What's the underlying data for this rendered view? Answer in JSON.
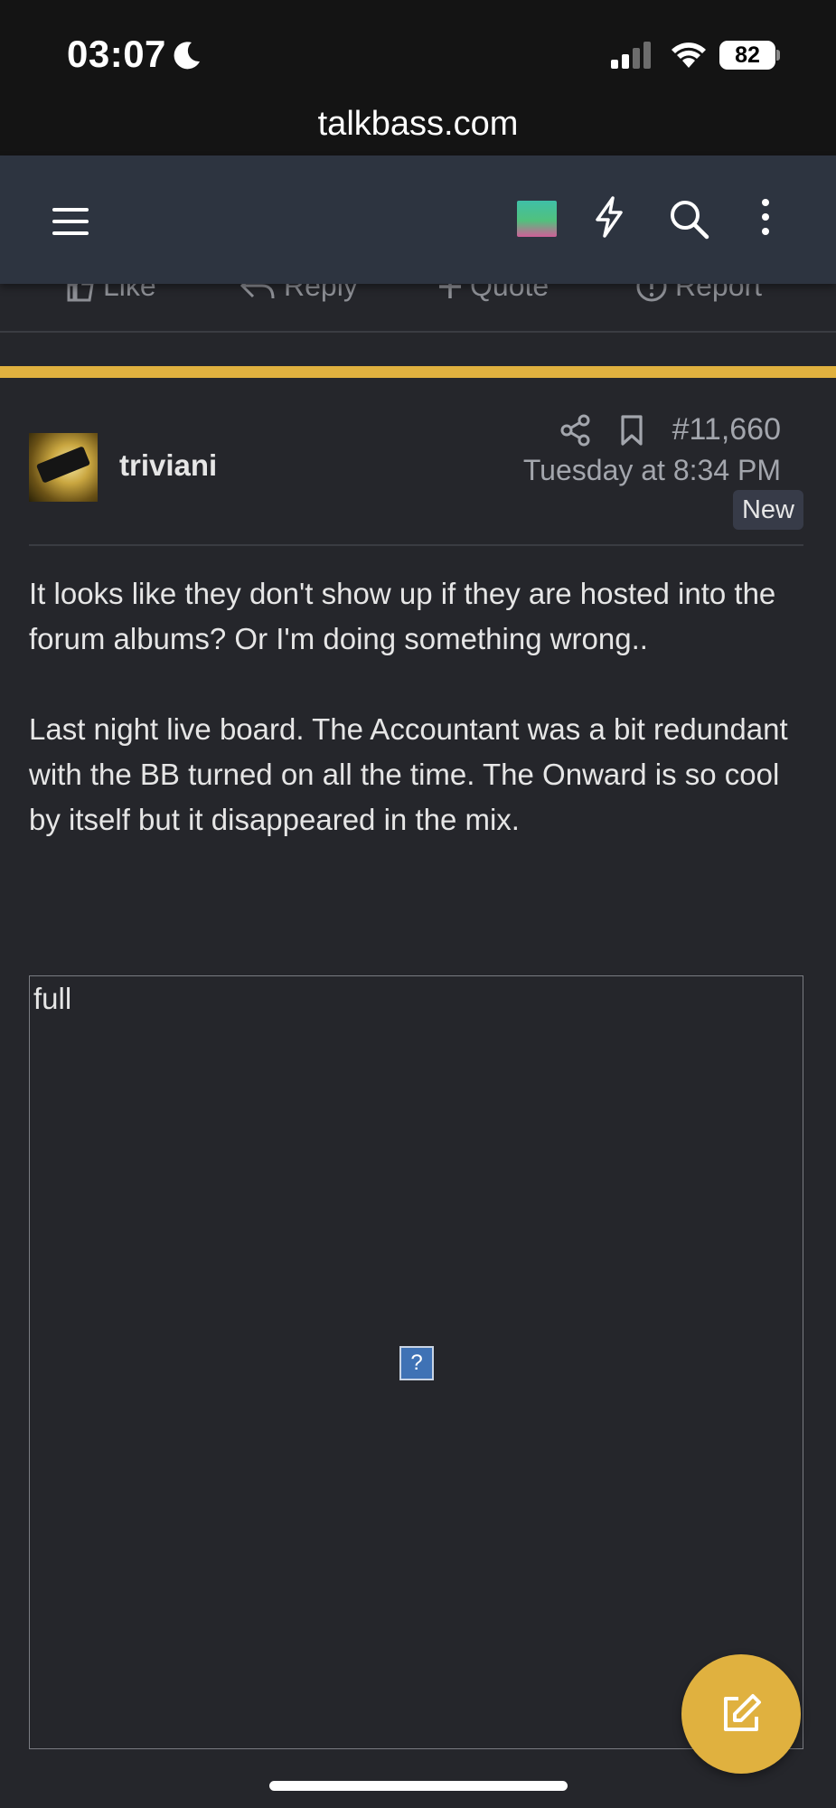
{
  "status_bar": {
    "time": "03:07",
    "battery": "82"
  },
  "browser": {
    "url": "talkbass.com"
  },
  "nav": {
    "icons": [
      "menu-icon",
      "user-avatar",
      "bolt-icon",
      "search-icon",
      "more-vertical-icon"
    ]
  },
  "previous_post_actions": {
    "like": "Like",
    "reply": "Reply",
    "quote": "Quote",
    "report": "Report"
  },
  "colors": {
    "accent": "#e0b13f",
    "background": "#25262b",
    "nav_background": "#2d3440"
  },
  "post": {
    "username": "triviani",
    "number": "#11,660",
    "date": "Tuesday at 8:34 PM",
    "badge": "New",
    "paragraphs": [
      "It looks like they don't show up if they are hosted into the forum albums? Or I'm doing something wrong..",
      "Last night live board. The Accountant was a bit redundant with the BB turned on all the time. The Onward is so cool by itself but it disappeared in the mix."
    ],
    "image_alt": "full",
    "broken_image_glyph": "?"
  }
}
